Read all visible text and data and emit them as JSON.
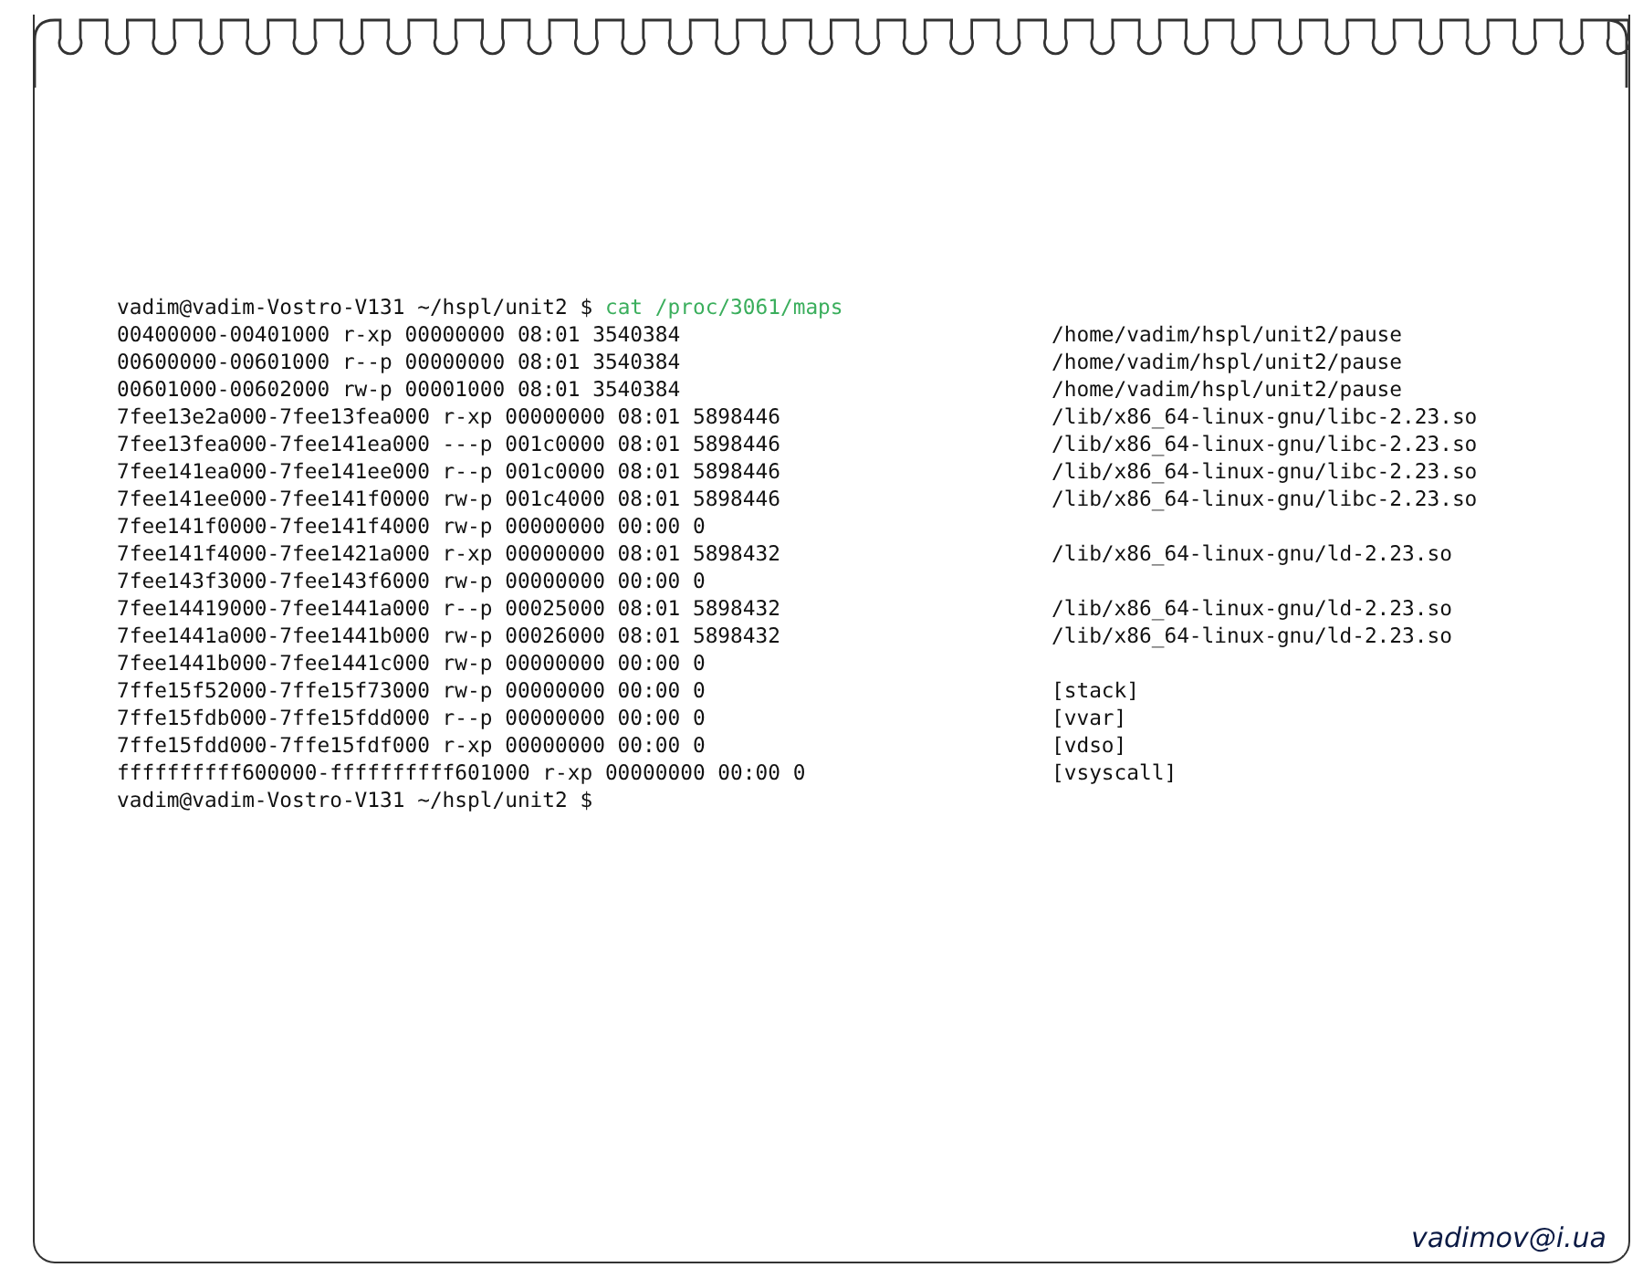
{
  "terminal": {
    "prompt": {
      "user_host": "vadim@vadim-Vostro-V131",
      "path": "~/hspl/unit2",
      "symbol": "$",
      "command": "cat /proc/3061/maps"
    },
    "rows": [
      {
        "mapping": "00400000-00401000 r-xp 00000000 08:01 3540384",
        "path": "/home/vadim/hspl/unit2/pause"
      },
      {
        "mapping": "00600000-00601000 r--p 00000000 08:01 3540384",
        "path": "/home/vadim/hspl/unit2/pause"
      },
      {
        "mapping": "00601000-00602000 rw-p 00001000 08:01 3540384",
        "path": "/home/vadim/hspl/unit2/pause"
      },
      {
        "mapping": "7fee13e2a000-7fee13fea000 r-xp 00000000 08:01 5898446",
        "path": "/lib/x86_64-linux-gnu/libc-2.23.so"
      },
      {
        "mapping": "7fee13fea000-7fee141ea000 ---p 001c0000 08:01 5898446",
        "path": "/lib/x86_64-linux-gnu/libc-2.23.so"
      },
      {
        "mapping": "7fee141ea000-7fee141ee000 r--p 001c0000 08:01 5898446",
        "path": "/lib/x86_64-linux-gnu/libc-2.23.so"
      },
      {
        "mapping": "7fee141ee000-7fee141f0000 rw-p 001c4000 08:01 5898446",
        "path": "/lib/x86_64-linux-gnu/libc-2.23.so"
      },
      {
        "mapping": "7fee141f0000-7fee141f4000 rw-p 00000000 00:00 0"
      },
      {
        "mapping": "7fee141f4000-7fee1421a000 r-xp 00000000 08:01 5898432",
        "path": "/lib/x86_64-linux-gnu/ld-2.23.so"
      },
      {
        "mapping": "7fee143f3000-7fee143f6000 rw-p 00000000 00:00 0"
      },
      {
        "mapping": "7fee14419000-7fee1441a000 r--p 00025000 08:01 5898432",
        "path": "/lib/x86_64-linux-gnu/ld-2.23.so"
      },
      {
        "mapping": "7fee1441a000-7fee1441b000 rw-p 00026000 08:01 5898432",
        "path": "/lib/x86_64-linux-gnu/ld-2.23.so"
      },
      {
        "mapping": "7fee1441b000-7fee1441c000 rw-p 00000000 00:00 0"
      },
      {
        "mapping": "7ffe15f52000-7ffe15f73000 rw-p 00000000 00:00 0",
        "path": "[stack]"
      },
      {
        "mapping": "7ffe15fdb000-7ffe15fdd000 r--p 00000000 00:00 0",
        "path": "[vvar]"
      },
      {
        "mapping": "7ffe15fdd000-7ffe15fdf000 r-xp 00000000 00:00 0",
        "path": "[vdso]"
      },
      {
        "mapping": "ffffffffff600000-ffffffffff601000 r-xp 00000000 00:00 0",
        "path": "[vsyscall]"
      }
    ],
    "final_prompt": {
      "user_host": "vadim@vadim-Vostro-V131",
      "path": "~/hspl/unit2",
      "symbol": "$"
    }
  },
  "footer": {
    "signature": "vadimov@i.ua"
  }
}
